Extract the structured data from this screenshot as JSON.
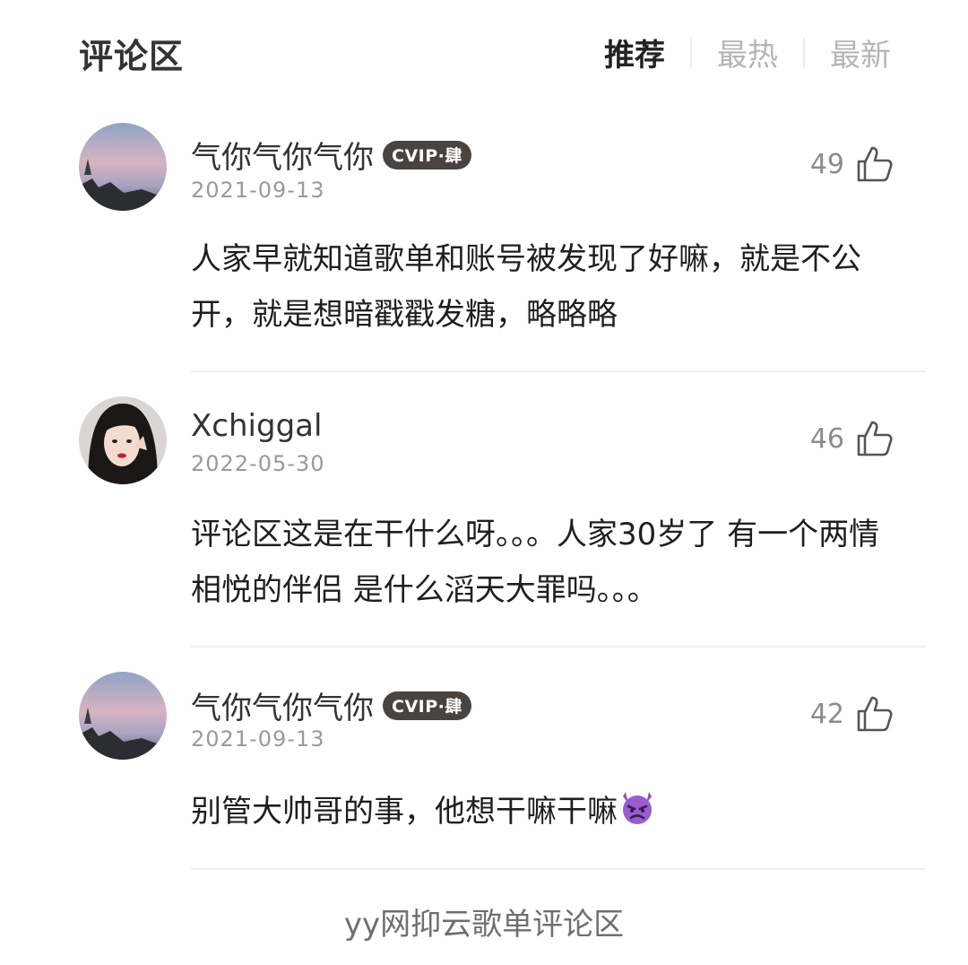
{
  "header": {
    "title": "评论区",
    "tabs": [
      {
        "label": "推荐",
        "active": true
      },
      {
        "label": "最热",
        "active": false
      },
      {
        "label": "最新",
        "active": false
      }
    ]
  },
  "comments": [
    {
      "username": "气你气你气你",
      "vip_badge": "CVIP·肆",
      "date": "2021-09-13",
      "likes": "49",
      "content": "人家早就知道歌单和账号被发现了好嘛，就是不公开，就是想暗戳戳发糖，略略略"
    },
    {
      "username": "Xchiggal",
      "vip_badge": "",
      "date": "2022-05-30",
      "likes": "46",
      "content": "评论区这是在干什么呀。。。人家30岁了 有一个两情相悦的伴侣 是什么滔天大罪吗。。。"
    },
    {
      "username": "气你气你气你",
      "vip_badge": "CVIP·肆",
      "date": "2021-09-13",
      "likes": "42",
      "content": "别管大帅哥的事，他想干嘛干嘛",
      "emoji": "angry-devil-emoji"
    }
  ],
  "icons": {
    "like": "thumbs-up-icon",
    "avatar_sunset": "sunset-sky-avatar",
    "avatar_portrait": "woman-portrait-avatar"
  },
  "footer_caption": "yy网抑云歌单评论区",
  "colors": {
    "badge_bg": "#4a4440",
    "active_tab": "#222222",
    "inactive_tab": "#b5b5b5",
    "meta_gray": "#9a9a9a"
  }
}
